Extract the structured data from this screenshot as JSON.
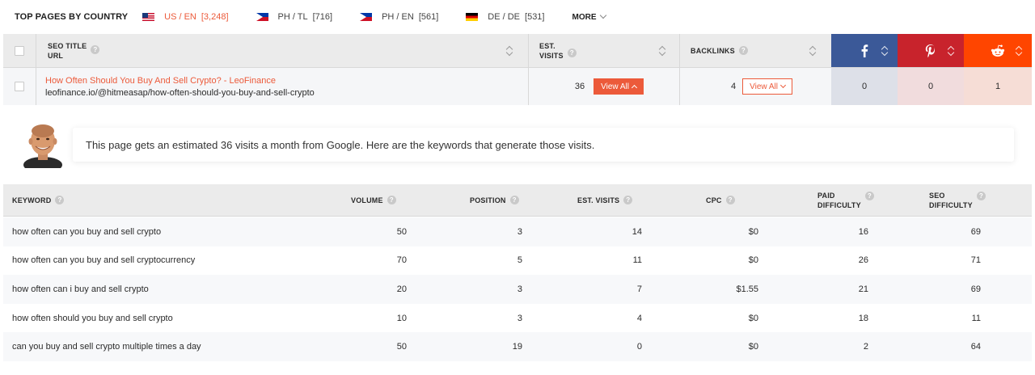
{
  "country_bar": {
    "title": "TOP PAGES BY COUNTRY",
    "countries": [
      {
        "flag": "us-flag",
        "code": "US / EN",
        "count": "[3,248]",
        "active": true
      },
      {
        "flag": "ph-flag",
        "code": "PH / TL",
        "count": "[716]",
        "active": false
      },
      {
        "flag": "ph-flag",
        "code": "PH / EN",
        "count": "[561]",
        "active": false
      },
      {
        "flag": "de-flag",
        "code": "DE / DE",
        "count": "[531]",
        "active": false
      }
    ],
    "more_label": "MORE"
  },
  "top_pages": {
    "headers": {
      "seo_title": "SEO TITLE",
      "url": "URL",
      "est": "EST.",
      "visits": "VISITS",
      "backlinks": "BACKLINKS"
    },
    "social_icons": [
      "facebook-icon",
      "pinterest-icon",
      "reddit-icon"
    ],
    "row": {
      "title": "How Often Should You Buy And Sell Crypto? - LeoFinance",
      "url": "leofinance.io/@hitmeasap/how-often-should-you-buy-and-sell-crypto",
      "est_visits": "36",
      "view_all_visits": "View All",
      "backlinks": "4",
      "view_all_backlinks": "View All",
      "facebook": "0",
      "pinterest": "0",
      "reddit": "1"
    }
  },
  "info_banner": {
    "text": "This page gets an estimated 36 visits a month from Google. Here are the keywords that generate those visits."
  },
  "keywords": {
    "headers": {
      "keyword": "KEYWORD",
      "volume": "VOLUME",
      "position": "POSITION",
      "est_visits": "EST. VISITS",
      "cpc": "CPC",
      "paid_1": "PAID",
      "paid_2": "DIFFICULTY",
      "seo_1": "SEO",
      "seo_2": "DIFFICULTY"
    },
    "rows": [
      {
        "keyword": "how often can you buy and sell crypto",
        "volume": "50",
        "position": "3",
        "visits": "14",
        "cpc": "$0",
        "paid": "16",
        "seo": "69"
      },
      {
        "keyword": "how often can you buy and sell cryptocurrency",
        "volume": "70",
        "position": "5",
        "visits": "11",
        "cpc": "$0",
        "paid": "26",
        "seo": "71"
      },
      {
        "keyword": "how often can i buy and sell crypto",
        "volume": "20",
        "position": "3",
        "visits": "7",
        "cpc": "$1.55",
        "paid": "21",
        "seo": "69"
      },
      {
        "keyword": "how often should you buy and sell crypto",
        "volume": "10",
        "position": "3",
        "visits": "4",
        "cpc": "$0",
        "paid": "18",
        "seo": "11"
      },
      {
        "keyword": "can you buy and sell crypto multiple times a day",
        "volume": "50",
        "position": "19",
        "visits": "0",
        "cpc": "$0",
        "paid": "2",
        "seo": "64"
      }
    ]
  },
  "colors": {
    "accent": "#ec5a3a",
    "facebook": "#3b5998",
    "pinterest": "#c8232c",
    "reddit": "#ff4500"
  }
}
